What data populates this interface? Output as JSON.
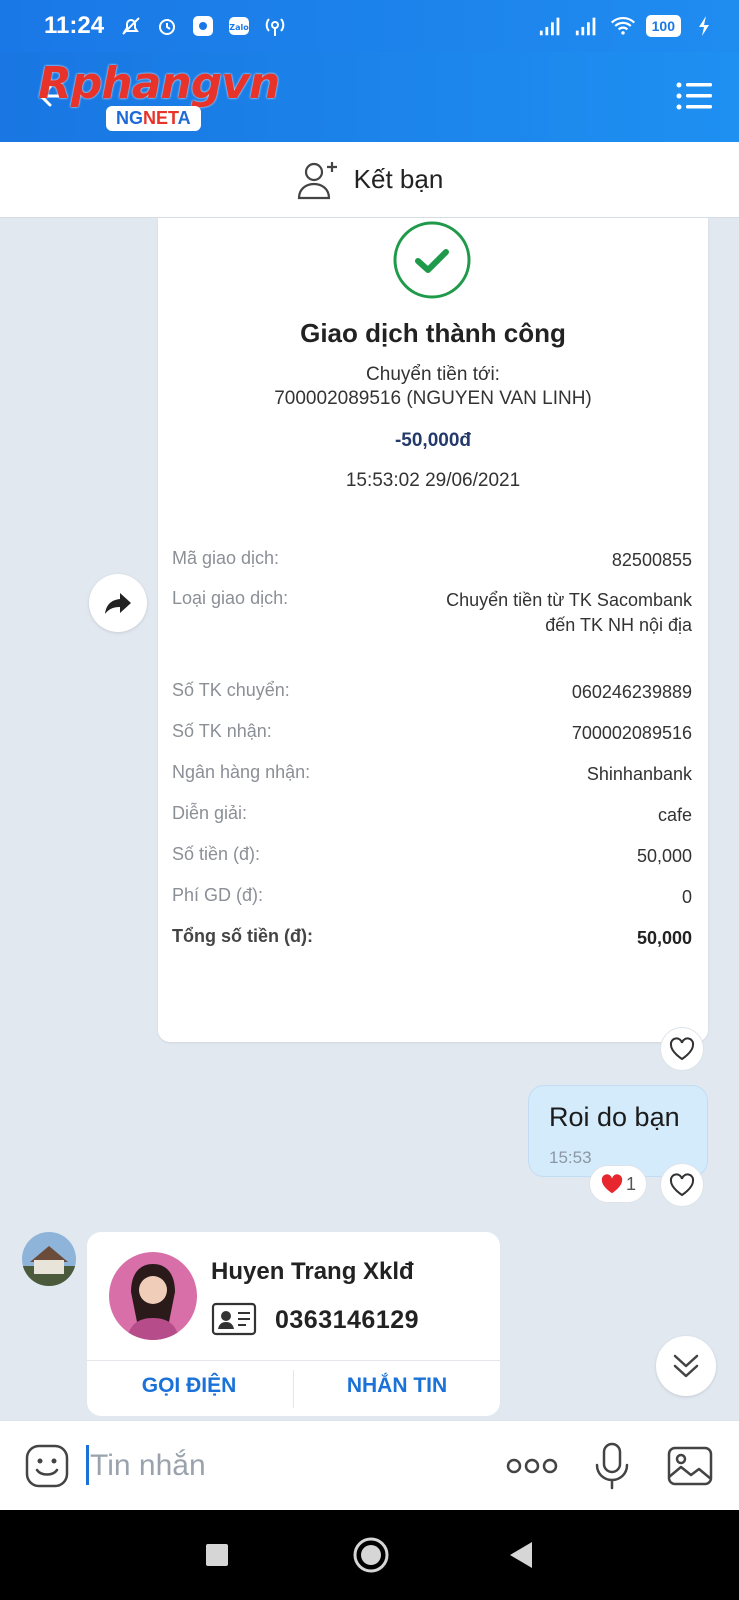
{
  "status_bar": {
    "time": "11:24",
    "battery": "100"
  },
  "header": {
    "logo_main": "Rphangvn",
    "logo_badge_prefix": "NG",
    "logo_badge_net": "NET",
    "logo_badge_suffix": "A"
  },
  "friend_bar": {
    "label": "Kết bạn"
  },
  "transaction": {
    "title": "Giao dịch thành công",
    "transfer_to_label": "Chuyển tiền tới:",
    "recipient": "700002089516 (NGUYEN VAN LINH)",
    "amount": "-50,000đ",
    "datetime": "15:53:02 29/06/2021",
    "details": [
      {
        "label": "Mã giao dịch:",
        "value": "82500855"
      },
      {
        "label": "Loại giao dịch:",
        "value": "Chuyển tiền từ TK Sacombank đến TK NH nội địa"
      },
      {
        "label": "Số TK chuyển:",
        "value": "060246239889"
      },
      {
        "label": "Số TK nhận:",
        "value": "700002089516"
      },
      {
        "label": "Ngân hàng nhận:",
        "value": "Shinhanbank"
      },
      {
        "label": "Diễn giải:",
        "value": "cafe"
      },
      {
        "label": "Số tiền (đ):",
        "value": "50,000"
      },
      {
        "label": "Phí GD (đ):",
        "value": "0"
      },
      {
        "label": "Tổng số tiền (đ):",
        "value": "50,000"
      }
    ]
  },
  "outgoing_message": {
    "text": "Roi do bạn",
    "time": "15:53",
    "reaction_count": "1"
  },
  "contact_card": {
    "name": "Huyen Trang Xklđ",
    "phone": "0363146129",
    "call_label": "GỌI ĐIỆN",
    "message_label": "NHẮN TIN"
  },
  "input": {
    "placeholder": "Tin nhắn"
  },
  "colors": {
    "header_blue": "#1e88ee",
    "accent_blue": "#1a72d8",
    "success_green": "#1f9a4a",
    "bubble_out": "#d4ebfc"
  }
}
